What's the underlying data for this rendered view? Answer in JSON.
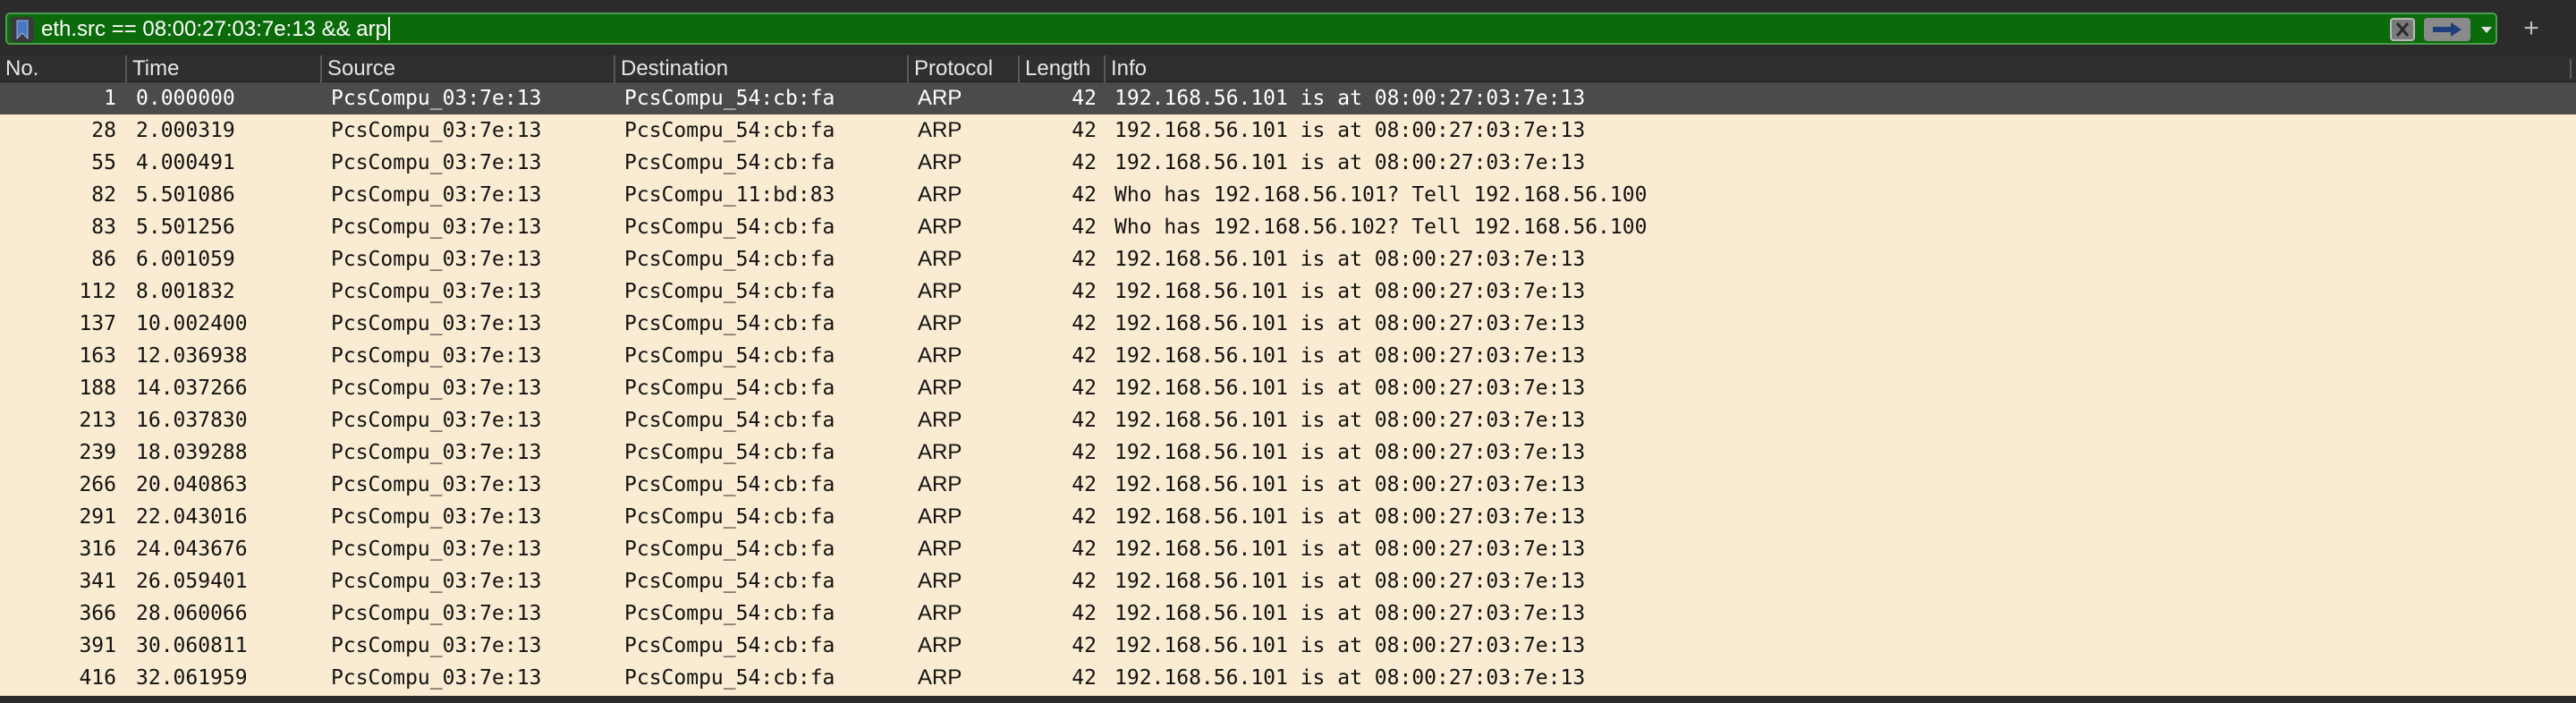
{
  "filter": {
    "expression": "eth.src == 08:00:27:03:7e:13 && arp",
    "bookmark_icon": "bookmark-icon",
    "clear_icon": "clear-icon",
    "apply_icon": "arrow-right-icon",
    "dropdown_icon": "chevron-down-icon",
    "add_label": "+"
  },
  "columns": {
    "no": "No.",
    "time": "Time",
    "source": "Source",
    "destination": "Destination",
    "protocol": "Protocol",
    "length": "Length",
    "info": "Info"
  },
  "colors": {
    "filter_valid_bg": "#0b6b0b",
    "row_bg": "#faecd2",
    "selected_row_bg": "#4b4b4b"
  },
  "packets": [
    {
      "no": "1",
      "time": "0.000000",
      "source": "PcsCompu_03:7e:13",
      "destination": "PcsCompu_54:cb:fa",
      "protocol": "ARP",
      "length": "42",
      "info": "192.168.56.101 is at 08:00:27:03:7e:13",
      "selected": true
    },
    {
      "no": "28",
      "time": "2.000319",
      "source": "PcsCompu_03:7e:13",
      "destination": "PcsCompu_54:cb:fa",
      "protocol": "ARP",
      "length": "42",
      "info": "192.168.56.101 is at 08:00:27:03:7e:13"
    },
    {
      "no": "55",
      "time": "4.000491",
      "source": "PcsCompu_03:7e:13",
      "destination": "PcsCompu_54:cb:fa",
      "protocol": "ARP",
      "length": "42",
      "info": "192.168.56.101 is at 08:00:27:03:7e:13"
    },
    {
      "no": "82",
      "time": "5.501086",
      "source": "PcsCompu_03:7e:13",
      "destination": "PcsCompu_11:bd:83",
      "protocol": "ARP",
      "length": "42",
      "info": "Who has 192.168.56.101? Tell 192.168.56.100"
    },
    {
      "no": "83",
      "time": "5.501256",
      "source": "PcsCompu_03:7e:13",
      "destination": "PcsCompu_54:cb:fa",
      "protocol": "ARP",
      "length": "42",
      "info": "Who has 192.168.56.102? Tell 192.168.56.100"
    },
    {
      "no": "86",
      "time": "6.001059",
      "source": "PcsCompu_03:7e:13",
      "destination": "PcsCompu_54:cb:fa",
      "protocol": "ARP",
      "length": "42",
      "info": "192.168.56.101 is at 08:00:27:03:7e:13"
    },
    {
      "no": "112",
      "time": "8.001832",
      "source": "PcsCompu_03:7e:13",
      "destination": "PcsCompu_54:cb:fa",
      "protocol": "ARP",
      "length": "42",
      "info": "192.168.56.101 is at 08:00:27:03:7e:13"
    },
    {
      "no": "137",
      "time": "10.002400",
      "source": "PcsCompu_03:7e:13",
      "destination": "PcsCompu_54:cb:fa",
      "protocol": "ARP",
      "length": "42",
      "info": "192.168.56.101 is at 08:00:27:03:7e:13"
    },
    {
      "no": "163",
      "time": "12.036938",
      "source": "PcsCompu_03:7e:13",
      "destination": "PcsCompu_54:cb:fa",
      "protocol": "ARP",
      "length": "42",
      "info": "192.168.56.101 is at 08:00:27:03:7e:13"
    },
    {
      "no": "188",
      "time": "14.037266",
      "source": "PcsCompu_03:7e:13",
      "destination": "PcsCompu_54:cb:fa",
      "protocol": "ARP",
      "length": "42",
      "info": "192.168.56.101 is at 08:00:27:03:7e:13"
    },
    {
      "no": "213",
      "time": "16.037830",
      "source": "PcsCompu_03:7e:13",
      "destination": "PcsCompu_54:cb:fa",
      "protocol": "ARP",
      "length": "42",
      "info": "192.168.56.101 is at 08:00:27:03:7e:13"
    },
    {
      "no": "239",
      "time": "18.039288",
      "source": "PcsCompu_03:7e:13",
      "destination": "PcsCompu_54:cb:fa",
      "protocol": "ARP",
      "length": "42",
      "info": "192.168.56.101 is at 08:00:27:03:7e:13"
    },
    {
      "no": "266",
      "time": "20.040863",
      "source": "PcsCompu_03:7e:13",
      "destination": "PcsCompu_54:cb:fa",
      "protocol": "ARP",
      "length": "42",
      "info": "192.168.56.101 is at 08:00:27:03:7e:13"
    },
    {
      "no": "291",
      "time": "22.043016",
      "source": "PcsCompu_03:7e:13",
      "destination": "PcsCompu_54:cb:fa",
      "protocol": "ARP",
      "length": "42",
      "info": "192.168.56.101 is at 08:00:27:03:7e:13"
    },
    {
      "no": "316",
      "time": "24.043676",
      "source": "PcsCompu_03:7e:13",
      "destination": "PcsCompu_54:cb:fa",
      "protocol": "ARP",
      "length": "42",
      "info": "192.168.56.101 is at 08:00:27:03:7e:13"
    },
    {
      "no": "341",
      "time": "26.059401",
      "source": "PcsCompu_03:7e:13",
      "destination": "PcsCompu_54:cb:fa",
      "protocol": "ARP",
      "length": "42",
      "info": "192.168.56.101 is at 08:00:27:03:7e:13"
    },
    {
      "no": "366",
      "time": "28.060066",
      "source": "PcsCompu_03:7e:13",
      "destination": "PcsCompu_54:cb:fa",
      "protocol": "ARP",
      "length": "42",
      "info": "192.168.56.101 is at 08:00:27:03:7e:13"
    },
    {
      "no": "391",
      "time": "30.060811",
      "source": "PcsCompu_03:7e:13",
      "destination": "PcsCompu_54:cb:fa",
      "protocol": "ARP",
      "length": "42",
      "info": "192.168.56.101 is at 08:00:27:03:7e:13"
    },
    {
      "no": "416",
      "time": "32.061959",
      "source": "PcsCompu_03:7e:13",
      "destination": "PcsCompu_54:cb:fa",
      "protocol": "ARP",
      "length": "42",
      "info": "192.168.56.101 is at 08:00:27:03:7e:13"
    }
  ]
}
